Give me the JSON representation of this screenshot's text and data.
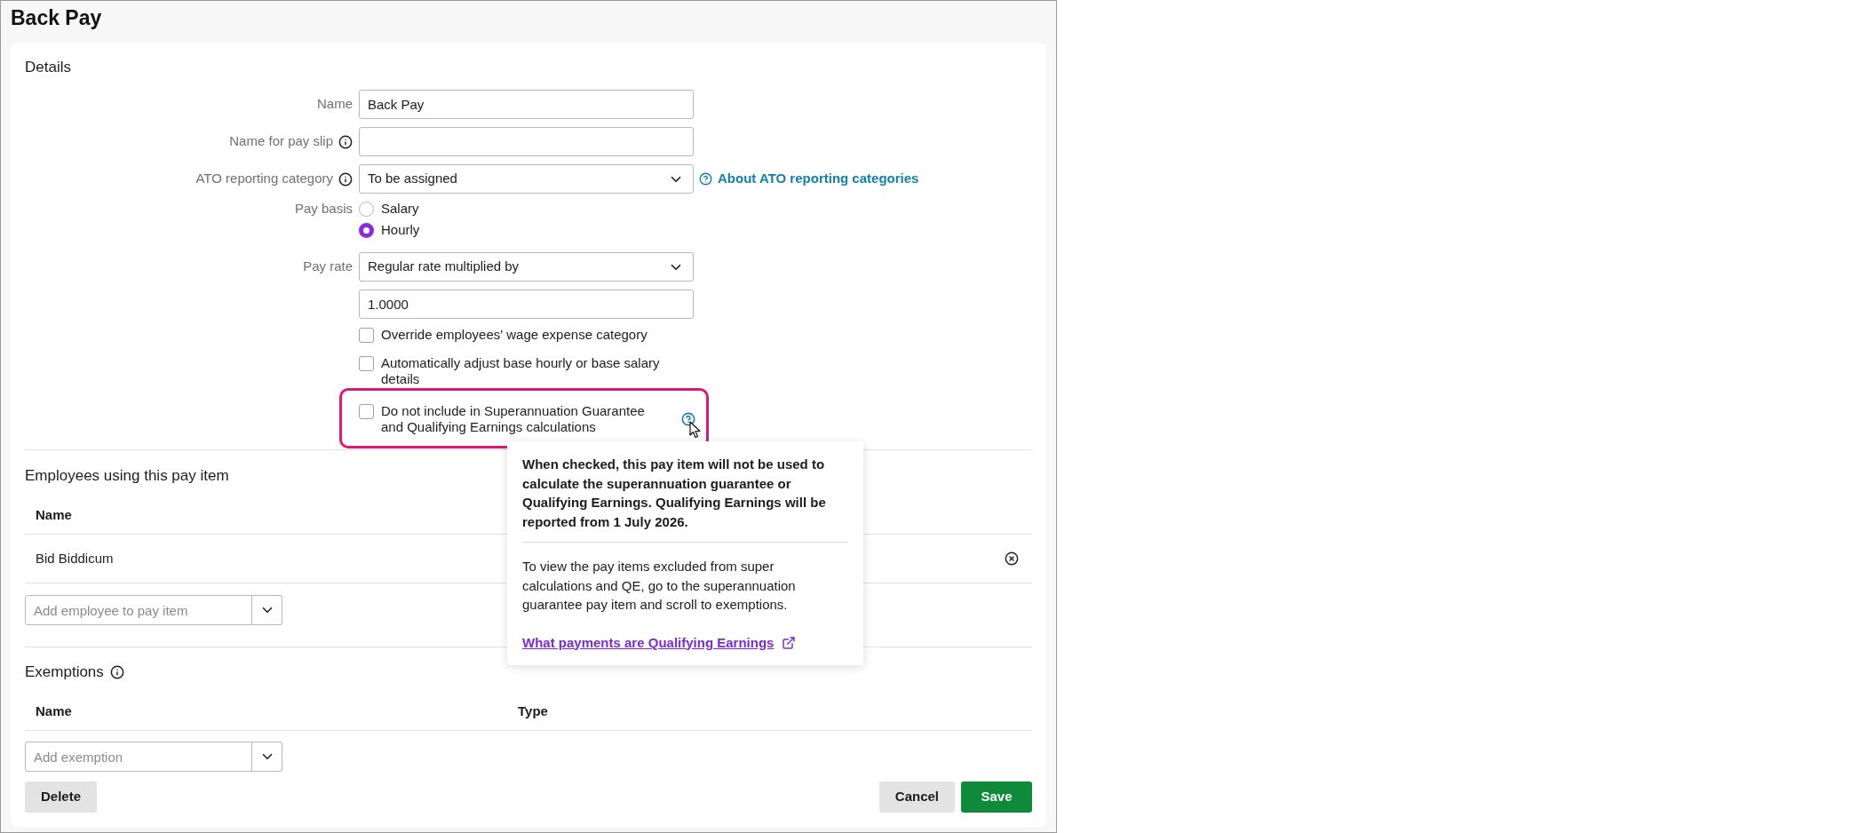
{
  "page": {
    "title": "Back Pay"
  },
  "details": {
    "heading": "Details",
    "fields": [
      {
        "kind": "text",
        "label": "Name",
        "info": false,
        "value": "Back Pay"
      },
      {
        "kind": "text",
        "label": "Name for pay slip",
        "info": true
      },
      {
        "kind": "select",
        "label": "ATO reporting category",
        "info": true,
        "value": "To be assigned",
        "help_link": "About ATO reporting categories"
      },
      {
        "kind": "radio",
        "label": "Pay basis",
        "info": false,
        "options": [
          {
            "label": "Salary",
            "selected": false
          },
          {
            "label": "Hourly",
            "selected": true
          }
        ]
      },
      {
        "kind": "select",
        "label": "Pay rate",
        "info": false,
        "value": "Regular rate multiplied by"
      },
      {
        "kind": "text",
        "value": "1.0000"
      },
      {
        "kind": "checkbox",
        "label": "Override employees' wage expense category",
        "checked": false,
        "highlighted": false
      },
      {
        "kind": "checkbox",
        "label": "Automatically adjust base hourly or base salary details",
        "checked": false,
        "highlighted": false
      },
      {
        "kind": "checkbox",
        "label": "Do not include in Superannuation Guarantee and Qualifying Earnings calculations",
        "checked": false,
        "highlighted": true,
        "help": true
      }
    ]
  },
  "tooltip": {
    "bold_text": "When checked, this pay item will not be used to calculate the superannuation guarantee or Qualifying Earnings. Qualifying Earnings will be reported from 1 July 2026.",
    "text": "To view the pay items excluded from super calculations and QE, go to the superannuation guarantee pay item and scroll to exemptions.",
    "link": "What payments are Qualifying Earnings"
  },
  "employees": {
    "heading": "Employees using this pay item",
    "columns": [
      "Name"
    ],
    "rows": [
      {
        "name": "Bid Biddicum"
      }
    ],
    "add_placeholder": "Add employee to pay item"
  },
  "exemptions": {
    "heading": "Exemptions",
    "info": true,
    "columns": [
      "Name",
      "Type"
    ],
    "add_placeholder": "Add exemption"
  },
  "actions": {
    "left": [
      {
        "label": "Delete",
        "kind": "secondary"
      }
    ],
    "right": [
      {
        "label": "Cancel",
        "kind": "secondary"
      },
      {
        "label": "Save",
        "kind": "primary"
      }
    ]
  }
}
